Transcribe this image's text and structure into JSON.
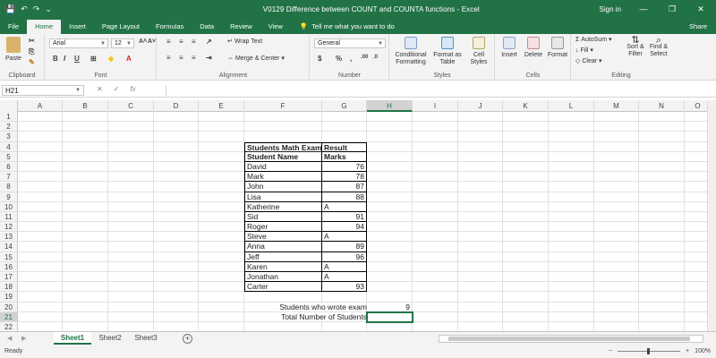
{
  "window": {
    "title": "V0129 Difference between COUNT and COUNTA functions - Excel",
    "signin": "Sign in",
    "share": "Share",
    "minimize_glyph": "—",
    "restore_glyph": "❐",
    "close_glyph": "✕"
  },
  "qat": {
    "save_glyph": "💾",
    "undo_glyph": "↶",
    "redo_glyph": "↷",
    "more_glyph": "⌄"
  },
  "tabs": [
    "File",
    "Home",
    "Insert",
    "Page Layout",
    "Formulas",
    "Data",
    "Review",
    "View"
  ],
  "tell_me": "Tell me what you want to do",
  "ribbon": {
    "clipboard": {
      "label": "Clipboard",
      "paste": "Paste"
    },
    "font": {
      "label": "Font",
      "name": "Arial",
      "size": "12",
      "bold": "B",
      "italic": "I",
      "underline": "U"
    },
    "alignment": {
      "label": "Alignment",
      "wrap": "Wrap Text",
      "merge": "Merge & Center"
    },
    "number": {
      "label": "Number",
      "format": "General",
      "currency": "$",
      "percent": "%",
      "comma": ","
    },
    "styles": {
      "label": "Styles",
      "conditional": "Conditional Formatting",
      "format_table": "Format as Table",
      "cell_styles": "Cell Styles"
    },
    "cells": {
      "label": "Cells",
      "insert": "Insert",
      "delete": "Delete",
      "format": "Format"
    },
    "editing": {
      "label": "Editing",
      "autosum": "AutoSum",
      "fill": "Fill",
      "clear": "Clear",
      "sort": "Sort & Filter",
      "find": "Find & Select"
    }
  },
  "formula_bar": {
    "name_box": "H21",
    "cancel": "✕",
    "enter": "✓",
    "fx": "fx",
    "value": ""
  },
  "columns": [
    "A",
    "B",
    "C",
    "D",
    "E",
    "F",
    "G",
    "H",
    "I",
    "J",
    "K",
    "L",
    "M",
    "N",
    "O"
  ],
  "selected_column": "H",
  "selected_row": 21,
  "rows": [
    {
      "n": "1"
    },
    {
      "n": "2"
    },
    {
      "n": "3"
    },
    {
      "n": "4",
      "F": "Students Math Exam Result"
    },
    {
      "n": "5",
      "F": "Student Name",
      "G": "Marks"
    },
    {
      "n": "6",
      "F": "David",
      "G": "76"
    },
    {
      "n": "7",
      "F": "Mark",
      "G": "78"
    },
    {
      "n": "8",
      "F": "John",
      "G": "87"
    },
    {
      "n": "9",
      "F": "Lisa",
      "G": "88"
    },
    {
      "n": "10",
      "F": "Katherine",
      "G": "A"
    },
    {
      "n": "11",
      "F": "Sid",
      "G": "91"
    },
    {
      "n": "12",
      "F": "Roger",
      "G": "94"
    },
    {
      "n": "13",
      "F": "Steve",
      "G": "A"
    },
    {
      "n": "14",
      "F": "Anna",
      "G": "89"
    },
    {
      "n": "15",
      "F": "Jeff",
      "G": "96"
    },
    {
      "n": "16",
      "F": "Karen",
      "G": "A"
    },
    {
      "n": "17",
      "F": "Jonathan",
      "G": "A"
    },
    {
      "n": "18",
      "F": "Carter",
      "G": "93"
    },
    {
      "n": "19"
    },
    {
      "n": "20",
      "F": "Students who wrote exam",
      "H": "9"
    },
    {
      "n": "21",
      "F": "Total Number of Students"
    },
    {
      "n": "22"
    }
  ],
  "sheets": [
    "Sheet1",
    "Sheet2",
    "Sheet3"
  ],
  "active_sheet": "Sheet1",
  "status": {
    "ready": "Ready",
    "zoom": "100%",
    "minus": "−",
    "plus": "+"
  },
  "colors": {
    "accent": "#217346"
  }
}
